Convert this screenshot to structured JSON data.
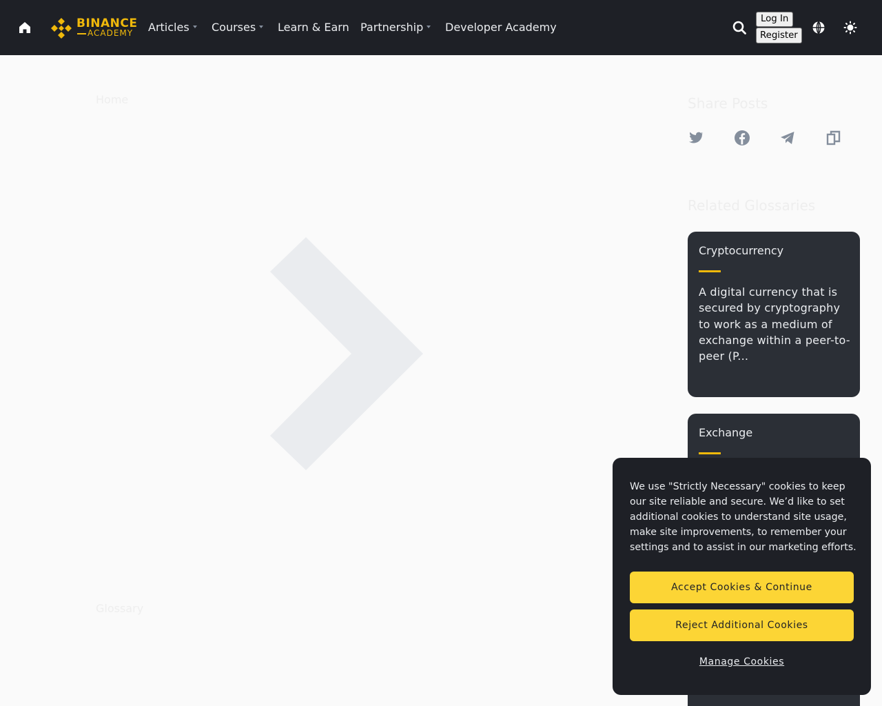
{
  "header": {
    "logo": {
      "line1": "BINANCE",
      "line2": "ACADEMY"
    },
    "nav": [
      {
        "label": "Articles",
        "dropdown": true
      },
      {
        "label": "Courses",
        "dropdown": true
      },
      {
        "label": "Learn & Earn",
        "dropdown": false
      },
      {
        "label": "Partnership",
        "dropdown": true
      },
      {
        "label": "Developer Academy",
        "dropdown": false
      }
    ],
    "login_label": "Log In",
    "register_label": "Register",
    "icons": [
      "home-icon",
      "search-icon",
      "globe-icon",
      "theme-toggle-icon"
    ]
  },
  "main": {
    "breadcrumb": "Home",
    "glossary_link": "Glossary"
  },
  "sidebar": {
    "share_title": "Share Posts",
    "share_icons": [
      "twitter-icon",
      "facebook-icon",
      "telegram-icon",
      "copy-link-icon"
    ],
    "related_title": "Related Glossaries",
    "cards": [
      {
        "title": "Cryptocurrency",
        "description": "A digital currency that is secured by cryptography to work as a medium of exchange within a peer-to-peer (P..."
      },
      {
        "title": "Exchange",
        "description": ""
      }
    ]
  },
  "cookie_banner": {
    "text": "We use \"Strictly Necessary\" cookies to keep our site reliable and secure. We’d like to set additional cookies to understand site usage, make site improvements, to remember your settings and to assist in our marketing efforts.",
    "accept_label": "Accept Cookies & Continue",
    "reject_label": "Reject Additional Cookies",
    "manage_label": "Manage Cookies"
  },
  "colors": {
    "header_bg": "#1e2026",
    "brand_yellow": "#f0b90b",
    "button_yellow": "#fcd535",
    "card_bg": "#2b2f36"
  }
}
